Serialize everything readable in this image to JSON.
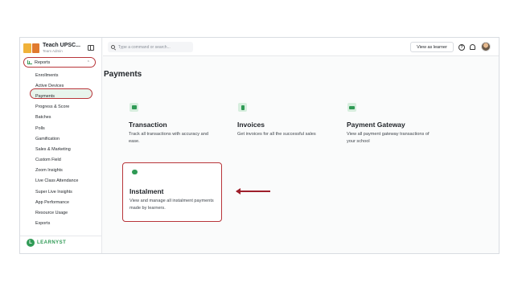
{
  "app": {
    "org_name": "Teach UPSC...",
    "org_role": "Team Admin",
    "brand_footer": "LEARNYST"
  },
  "topbar": {
    "search_placeholder": "Type a command or search...",
    "view_as_learner": "View as learner",
    "help_icon": "help-icon",
    "bell_icon": "bell-icon"
  },
  "sidebar": {
    "section": "Reports",
    "items": [
      {
        "label": "Enrollments"
      },
      {
        "label": "Active Devices"
      },
      {
        "label": "Payments",
        "active": true
      },
      {
        "label": "Progress & Score"
      },
      {
        "label": "Batches"
      },
      {
        "label": "Polls"
      },
      {
        "label": "Gamification"
      },
      {
        "label": "Sales & Marketing"
      },
      {
        "label": "Custom Field"
      },
      {
        "label": "Zoom Insights"
      },
      {
        "label": "Live Class Attendance"
      },
      {
        "label": "Super Live Insights"
      },
      {
        "label": "App Performance"
      },
      {
        "label": "Resource Usage"
      },
      {
        "label": "Exports"
      }
    ]
  },
  "main": {
    "title": "Payments",
    "cards": [
      {
        "title": "Transaction",
        "desc": "Track all transactions with accuracy and ease.",
        "icon": "cash-icon"
      },
      {
        "title": "Invoices",
        "desc": "Get invoices for all the successful sales",
        "icon": "invoice-icon"
      },
      {
        "title": "Payment Gateway",
        "desc": "View all payment gateway transactions of your school",
        "icon": "card-icon"
      },
      {
        "title": "Instalment",
        "desc": "View and manage all instalment payments made by learners.",
        "icon": "hand-coin-icon"
      }
    ]
  },
  "colors": {
    "accent_green": "#2f9a55",
    "highlight_red": "#b8353a"
  }
}
